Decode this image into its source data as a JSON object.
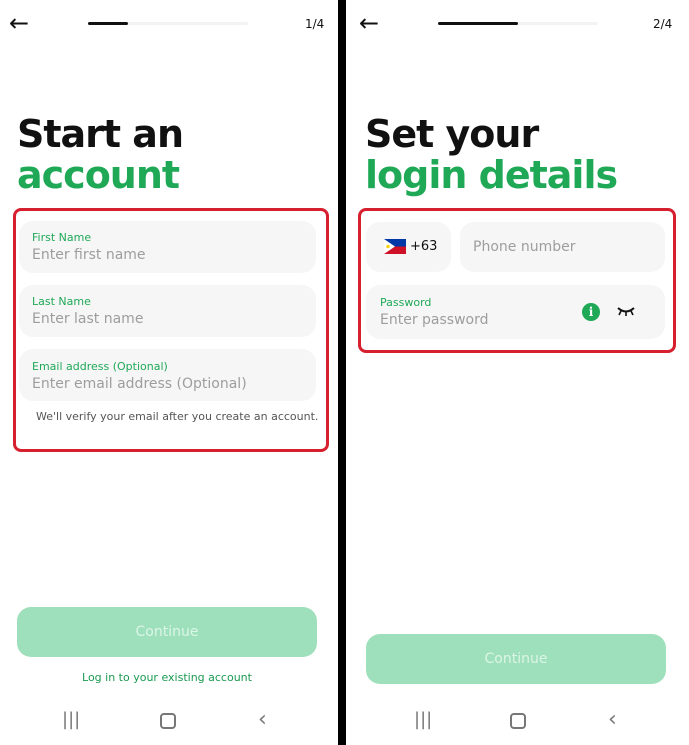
{
  "screen1": {
    "step": "1/4",
    "title_line1": "Start an",
    "title_line2": "account",
    "first_name": {
      "label": "First Name",
      "placeholder": "Enter first name"
    },
    "last_name": {
      "label": "Last Name",
      "placeholder": "Enter last name"
    },
    "email": {
      "label": "Email address (Optional)",
      "placeholder": "Enter email address (Optional)"
    },
    "email_note": "We'll verify your email after you create an account.",
    "continue_label": "Continue",
    "login_link": "Log in to your existing account",
    "progress": 0.25
  },
  "screen2": {
    "step": "2/4",
    "title_line1": "Set your",
    "title_line2": "login details",
    "country_code": "+63",
    "phone_placeholder": "Phone number",
    "password": {
      "label": "Password",
      "placeholder": "Enter password"
    },
    "info_glyph": "i",
    "continue_label": "Continue",
    "progress": 0.5
  },
  "icons": {
    "back": "arrow-left-icon",
    "flag": "philippines-flag-icon",
    "info": "info-icon",
    "eye": "eye-closed-icon",
    "nav_recents": "recents-icon",
    "nav_home": "home-icon",
    "nav_back": "chevron-left-icon"
  },
  "glyphs": {
    "back": "←",
    "recents": "|||",
    "nav_back": "‹"
  },
  "colors": {
    "accent": "#1fa957",
    "highlight": "#d6202f",
    "button_disabled": "#9fe0bc"
  }
}
